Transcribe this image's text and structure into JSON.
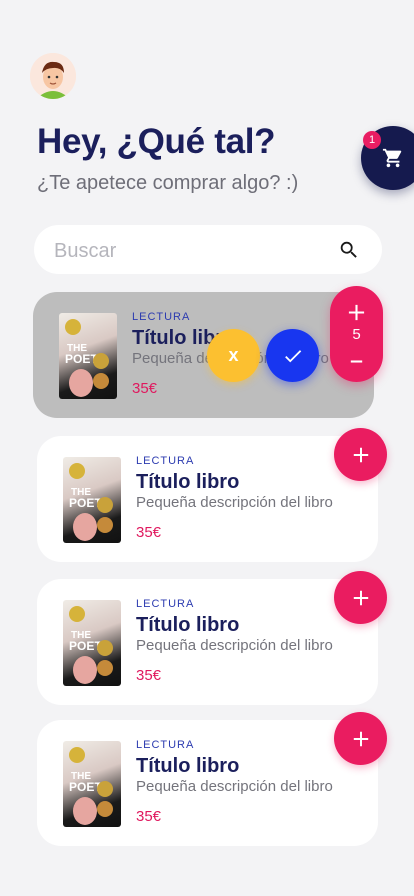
{
  "header": {
    "greeting": "Hey, ¿Qué tal?",
    "subtitle": "¿Te apetece comprar algo? :)"
  },
  "cart": {
    "icon": "cart-icon",
    "badge_count": "1"
  },
  "search": {
    "placeholder": "Buscar",
    "icon": "search-icon"
  },
  "selected_item": {
    "category": "LECTURA",
    "title": "Título libro",
    "description": "Pequeña descripción del libro",
    "price": "35€",
    "quantity": "5",
    "cancel_label": "x",
    "confirm_icon": "check-icon"
  },
  "products": [
    {
      "category": "LECTURA",
      "title": "Título libro",
      "description": "Pequeña descripción del libro",
      "price": "35€"
    },
    {
      "category": "LECTURA",
      "title": "Título libro",
      "description": "Pequeña descripción del libro",
      "price": "35€"
    },
    {
      "category": "LECTURA",
      "title": "Título libro",
      "description": "Pequeña descripción del libro",
      "price": "35€"
    }
  ],
  "colors": {
    "primary": "#1b1f5c",
    "accent": "#ea1c60",
    "confirm": "#1836f0",
    "cancel": "#fcc030",
    "category": "#2c3bb0"
  }
}
